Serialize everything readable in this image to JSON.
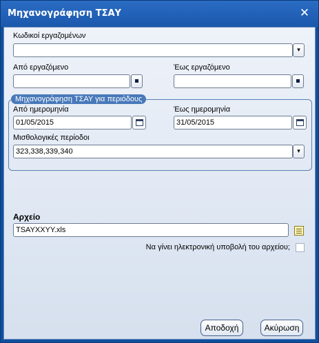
{
  "window": {
    "title": "Μηχανογράφηση ΤΣΑΥ",
    "close_symbol": "✕"
  },
  "employee_codes": {
    "label": "Κωδικοί εργαζομένων",
    "value": "",
    "dropdown_icon": "chevron-down-icon"
  },
  "from_employee": {
    "label": "Από εργαζόμενο",
    "value": ""
  },
  "to_employee": {
    "label": "Έως εργαζόμενο",
    "value": ""
  },
  "period_group": {
    "caption": "Μηχανογράφηση ΤΣΑΥ για περιόδους",
    "from_date": {
      "label": "Από ημερομηνία",
      "value": "01/05/2015"
    },
    "to_date": {
      "label": "Έως ημερομηνία",
      "value": "31/05/2015"
    },
    "payroll_periods": {
      "label": "Μισθολογικές περίοδοι",
      "value": "323,338,339,340"
    }
  },
  "file": {
    "label": "Αρχείο",
    "value": "TSAYXXYY.xls"
  },
  "electronic_submission": {
    "label": "Να γίνει ηλεκτρονική υποβολή του αρχείου;",
    "checked": false
  },
  "buttons": {
    "accept": "Αποδοχή",
    "cancel": "Ακύρωση"
  }
}
